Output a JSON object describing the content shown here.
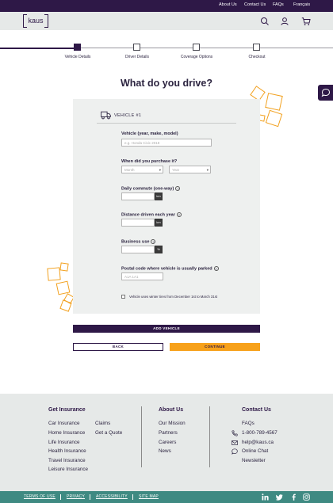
{
  "topbar": {
    "links": [
      "About Us",
      "Contact Us",
      "FAQs",
      "Français"
    ]
  },
  "header": {
    "logo": "kaus",
    "icons": [
      "search-icon",
      "user-icon",
      "cart-icon"
    ]
  },
  "progress": {
    "steps": [
      "Vehicle Details",
      "Driver Details",
      "Coverage Options",
      "Checkout"
    ],
    "active_step": 1
  },
  "page": {
    "title": "What do you drive?"
  },
  "form": {
    "vehicle_header": "VEHICLE #1",
    "vehicle_label": "Vehicle (year, make, model)",
    "vehicle_placeholder": "e.g. Honda Civic 2018",
    "purchase_label": "When did you purchase it?",
    "month_placeholder": "Month",
    "year_placeholder": "Year",
    "commute_label": "Daily commute (one-way)",
    "commute_unit": "km",
    "distance_label": "Distance driven each year",
    "distance_unit": "km",
    "business_label": "Business use",
    "business_unit": "%",
    "postal_label": "Postal code where vehicle is usually parked",
    "postal_placeholder": "A1A 1A1",
    "winter_tires_label": "Vehicle uses winter tires from December 1st to March 31st"
  },
  "buttons": {
    "add_vehicle": "ADD VEHICLE",
    "back": "BACK",
    "continue": "CONTINUE"
  },
  "footer": {
    "insurance": {
      "heading": "Get Insurance",
      "col1": [
        "Car Insurance",
        "Home Insurance",
        "Life Insurance",
        "Health Insurance",
        "Travel Insurance",
        "Leisure Insurance"
      ],
      "col2": [
        "Claims",
        "Get a Quote"
      ]
    },
    "about": {
      "heading": "About Us",
      "links": [
        "Our Mission",
        "Partners",
        "Careers",
        "News"
      ]
    },
    "contact": {
      "heading": "Contact Us",
      "faqs": "FAQs",
      "phone": "1-800-789-4567",
      "email": "help@kaus.ca",
      "chat": "Online Chat",
      "newsletter": "Newsletter"
    }
  },
  "bottombar": {
    "links": [
      "TERMS OF USE",
      "PRIVACY",
      "ACCESSIBILITY",
      "SITE MAP"
    ],
    "social": [
      "linkedin-icon",
      "twitter-icon",
      "facebook-icon",
      "instagram-icon"
    ]
  },
  "colors": {
    "brand_purple": "#2e1847",
    "accent_orange": "#f7a11a",
    "footer_teal": "#3f8a82"
  }
}
